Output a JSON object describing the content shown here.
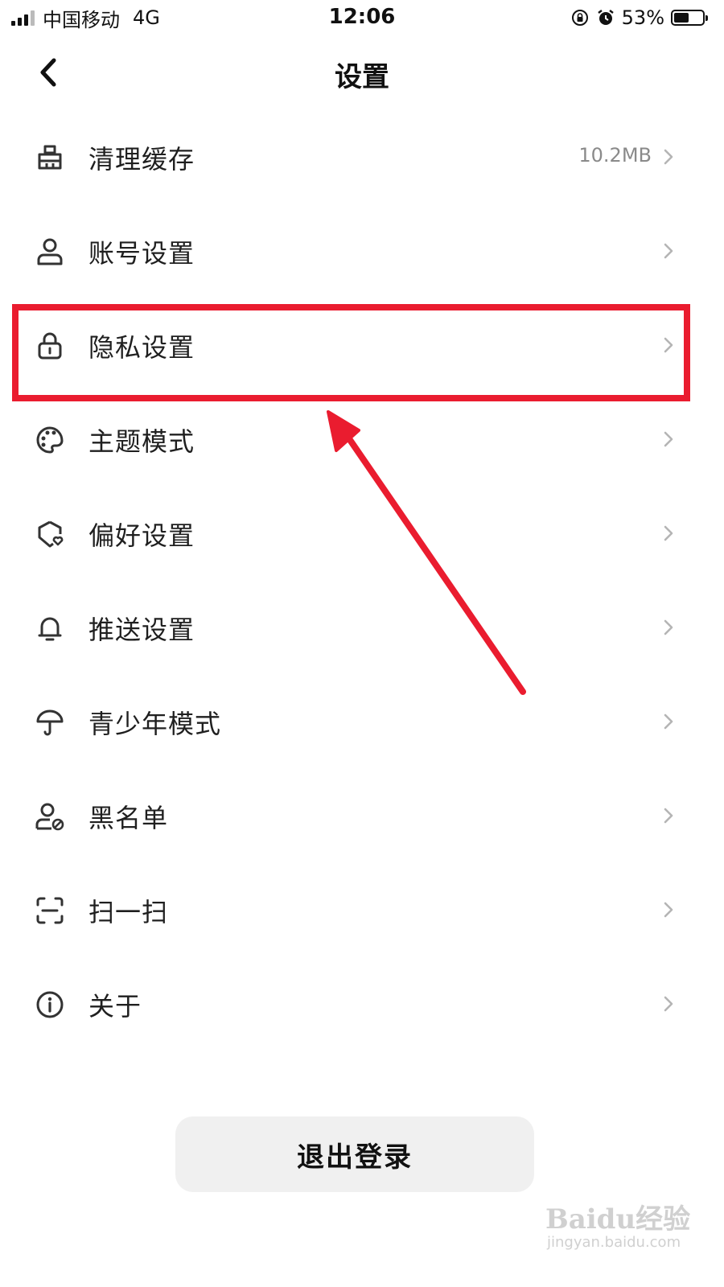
{
  "status_bar": {
    "carrier": "中国移动",
    "network": "4G",
    "time": "12:06",
    "battery_percent_text": "53%",
    "battery_level": 0.53
  },
  "header": {
    "title": "设置"
  },
  "settings": [
    {
      "label": "清理缓存",
      "value": "10.2MB",
      "icon": "broom-icon"
    },
    {
      "label": "账号设置",
      "value": "",
      "icon": "user-icon"
    },
    {
      "label": "隐私设置",
      "value": "",
      "icon": "lock-icon"
    },
    {
      "label": "主题模式",
      "value": "",
      "icon": "palette-icon"
    },
    {
      "label": "偏好设置",
      "value": "",
      "icon": "heart-shield-icon"
    },
    {
      "label": "推送设置",
      "value": "",
      "icon": "bell-icon"
    },
    {
      "label": "青少年模式",
      "value": "",
      "icon": "umbrella-icon"
    },
    {
      "label": "黑名单",
      "value": "",
      "icon": "user-block-icon"
    },
    {
      "label": "扫一扫",
      "value": "",
      "icon": "scan-icon"
    },
    {
      "label": "关于",
      "value": "",
      "icon": "info-icon"
    }
  ],
  "logout": {
    "label": "退出登录"
  },
  "annotation": {
    "highlight_color": "#ea1c2f",
    "highlighted_item": "隐私设置"
  },
  "watermark": {
    "brand": "Baidu经验",
    "url": "jingyan.baidu.com"
  }
}
